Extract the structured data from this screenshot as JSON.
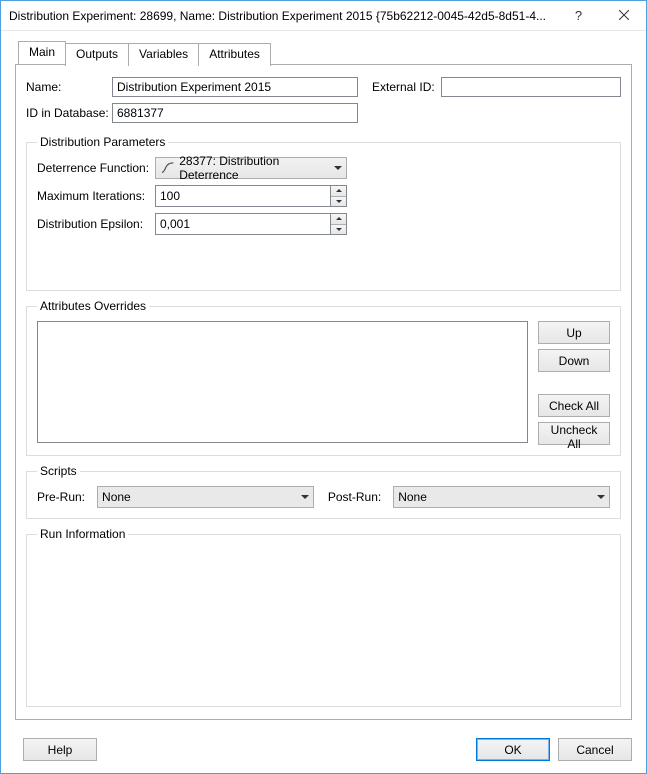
{
  "titlebar": {
    "title": "Distribution Experiment: 28699, Name: Distribution Experiment 2015 {75b62212-0045-42d5-8d51-4...",
    "help_glyph": "?",
    "close_glyph": "✕"
  },
  "tabs": {
    "main": "Main",
    "outputs": "Outputs",
    "variables": "Variables",
    "attributes": "Attributes"
  },
  "main": {
    "name_label": "Name:",
    "name_value": "Distribution Experiment 2015",
    "external_id_label": "External ID:",
    "external_id_value": "",
    "db_id_label": "ID in Database:",
    "db_id_value": "6881377",
    "dist_params": {
      "legend": "Distribution Parameters",
      "deterrence_label": "Deterrence Function:",
      "deterrence_value": "28377: Distribution Deterrence",
      "max_iter_label": "Maximum Iterations:",
      "max_iter_value": "100",
      "epsilon_label": "Distribution Epsilon:",
      "epsilon_value": "0,001"
    },
    "attr_overrides": {
      "legend": "Attributes Overrides",
      "up": "Up",
      "down": "Down",
      "check_all": "Check All",
      "uncheck_all": "Uncheck All"
    },
    "scripts": {
      "legend": "Scripts",
      "pre_label": "Pre-Run:",
      "pre_value": "None",
      "post_label": "Post-Run:",
      "post_value": "None"
    },
    "run_info": {
      "legend": "Run Information"
    }
  },
  "footer": {
    "help": "Help",
    "ok": "OK",
    "cancel": "Cancel"
  }
}
